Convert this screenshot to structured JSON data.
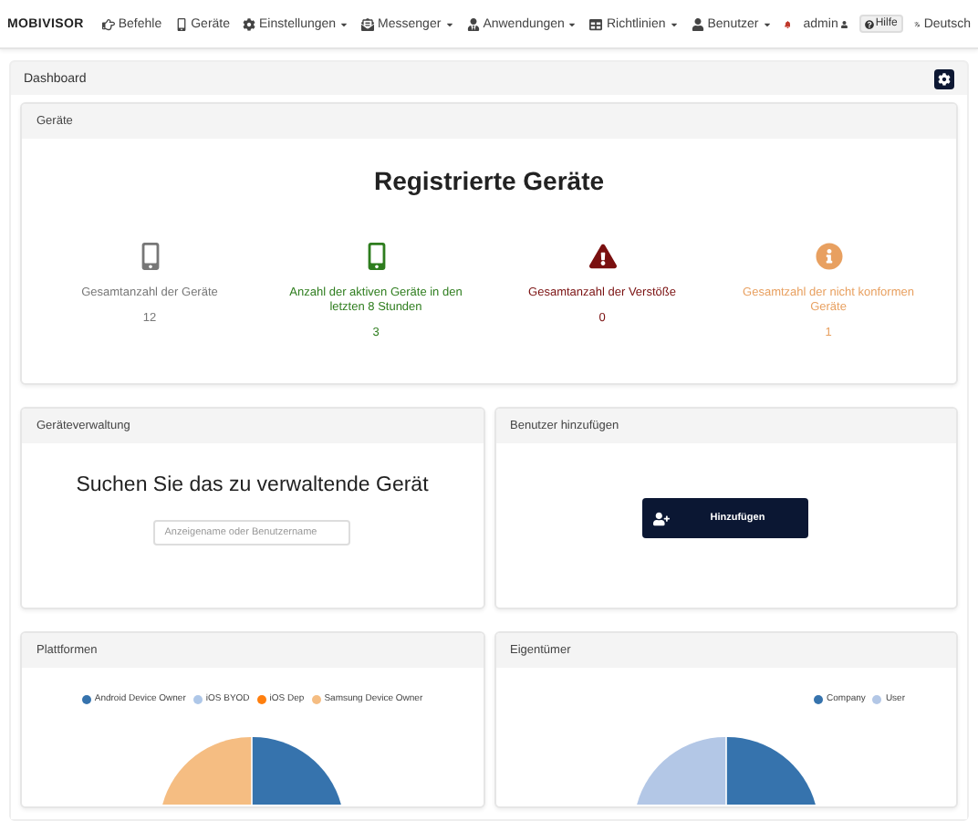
{
  "navbar": {
    "brand": "MOBIVISOR",
    "items": [
      {
        "kind": "hand",
        "label": "Befehle",
        "dropdown": false
      },
      {
        "kind": "phone",
        "label": "Geräte",
        "dropdown": false
      },
      {
        "kind": "gear",
        "label": "Einstellungen",
        "dropdown": true
      },
      {
        "kind": "envelope",
        "label": "Messenger",
        "dropdown": true
      },
      {
        "kind": "person",
        "label": "Anwendungen",
        "dropdown": true
      },
      {
        "kind": "table",
        "label": "Richtlinien",
        "dropdown": true
      },
      {
        "kind": "user",
        "label": "Benutzer",
        "dropdown": true
      }
    ],
    "user": "admin",
    "help": "Hilfe",
    "language": "Deutsch"
  },
  "dashboard": {
    "title": "Dashboard"
  },
  "devices": {
    "title": "Geräte",
    "heading": "Registrierte Geräte",
    "stats": [
      {
        "kind": "phone",
        "label": "Gesamtanzahl der Geräte",
        "value": "12",
        "color": "#777777"
      },
      {
        "kind": "phone",
        "label": "Anzahl der aktiven Geräte in den letzten 8 Stunden",
        "value": "3",
        "color": "#2e7d1e"
      },
      {
        "kind": "warning",
        "label": "Gesamtanzahl der Verstöße",
        "value": "0",
        "color": "#7a1010"
      },
      {
        "kind": "info",
        "label": "Gesamtzahl der nicht konformen Geräte",
        "value": "1",
        "color": "#e8a060"
      }
    ]
  },
  "management": {
    "title": "Geräteverwaltung",
    "heading": "Suchen Sie das zu verwaltende Gerät",
    "placeholder": "Anzeigename oder Benutzername"
  },
  "add_user": {
    "title": "Benutzer hinzufügen",
    "button": "Hinzufügen"
  },
  "charts": [
    {
      "title": "Plattformen",
      "legend": [
        {
          "label": "Android Device Owner",
          "color": "#3673ad"
        },
        {
          "label": "iOS BYOD",
          "color": "#aec7e8"
        },
        {
          "label": "iOS Dep",
          "color": "#ff7f0e"
        },
        {
          "label": "Samsung Device Owner",
          "color": "#f5bd82"
        }
      ]
    },
    {
      "title": "Eigentümer",
      "legend": [
        {
          "label": "Company",
          "color": "#3673ad"
        },
        {
          "label": "User",
          "color": "#b3c7e6"
        }
      ]
    }
  ]
}
